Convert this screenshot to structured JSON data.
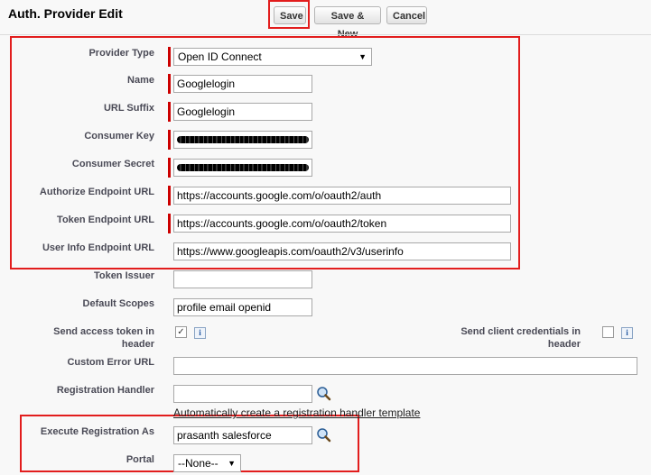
{
  "header": {
    "title": "Auth. Provider Edit",
    "save_label": "Save",
    "save_new_label": "Save & New",
    "cancel_label": "Cancel"
  },
  "form": {
    "provider_type": {
      "label": "Provider Type",
      "value": "Open ID Connect"
    },
    "name": {
      "label": "Name",
      "value": "Googlelogin"
    },
    "url_suffix": {
      "label": "URL Suffix",
      "value": "Googlelogin"
    },
    "consumer_key": {
      "label": "Consumer Key",
      "value": "[redacted]"
    },
    "consumer_secret": {
      "label": "Consumer Secret",
      "value": "[redacted]"
    },
    "authorize_endpoint": {
      "label": "Authorize Endpoint URL",
      "value": "https://accounts.google.com/o/oauth2/auth"
    },
    "token_endpoint": {
      "label": "Token Endpoint URL",
      "value": "https://accounts.google.com/o/oauth2/token"
    },
    "userinfo_endpoint": {
      "label": "User Info Endpoint URL",
      "value": "https://www.googleapis.com/oauth2/v3/userinfo"
    },
    "token_issuer": {
      "label": "Token Issuer",
      "value": ""
    },
    "default_scopes": {
      "label": "Default Scopes",
      "value": "profile email openid"
    },
    "send_access_token": {
      "label_line1": "Send access token in",
      "label_line2": "header",
      "checked": true
    },
    "send_client_credentials": {
      "label_line1": "Send client credentials in",
      "label_line2": "header",
      "checked": false
    },
    "custom_error_url": {
      "label": "Custom Error URL",
      "value": ""
    },
    "registration_handler": {
      "label": "Registration Handler",
      "value": "",
      "link": "Automatically create a registration handler template"
    },
    "execute_registration_as": {
      "label": "Execute Registration As",
      "value": "prasanth salesforce"
    },
    "portal": {
      "label": "Portal",
      "value": "--None--"
    }
  },
  "icons": {
    "dropdown": "▼",
    "check": "✓",
    "info": "i"
  },
  "colors": {
    "highlight": "#e21d1d",
    "required": "#cc0000"
  }
}
